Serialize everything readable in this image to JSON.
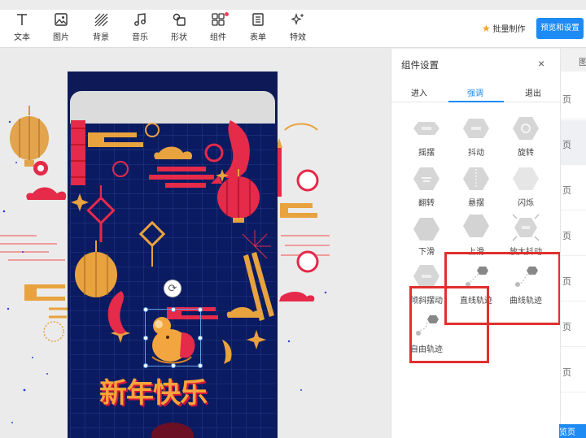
{
  "toolbar": {
    "tools": [
      {
        "label": "文本",
        "icon": "text-icon"
      },
      {
        "label": "图片",
        "icon": "image-icon"
      },
      {
        "label": "背景",
        "icon": "background-icon"
      },
      {
        "label": "音乐",
        "icon": "music-icon"
      },
      {
        "label": "形状",
        "icon": "shape-icon"
      },
      {
        "label": "组件",
        "icon": "component-icon"
      },
      {
        "label": "表单",
        "icon": "form-icon"
      },
      {
        "label": "特效",
        "icon": "effects-icon"
      }
    ],
    "batch_label": "批量制作",
    "preview_label": "预览和设置"
  },
  "canvas": {
    "greeting": "新年快乐"
  },
  "panel": {
    "title": "组件设置",
    "close": "×",
    "tabs": [
      "进入",
      "强调",
      "退出"
    ],
    "active_tab": "强调",
    "effects": [
      "摇摆",
      "抖动",
      "旋转",
      "翻转",
      "悬摆",
      "闪烁",
      "下滑",
      "上滑",
      "放大抖动",
      "倾斜摆动",
      "直线轨迹",
      "曲线轨迹",
      "自由轨迹"
    ]
  },
  "sidebar": {
    "head": "图",
    "items": [
      "页",
      "页",
      "页",
      "页",
      "页",
      "页",
      "页"
    ],
    "button": "览页"
  },
  "colors": {
    "accent": "#1e8bf5",
    "highlight": "#e0302d",
    "poster_bg": "#0b1b61",
    "gold": "#f9a43a",
    "red": "#d6153c"
  }
}
